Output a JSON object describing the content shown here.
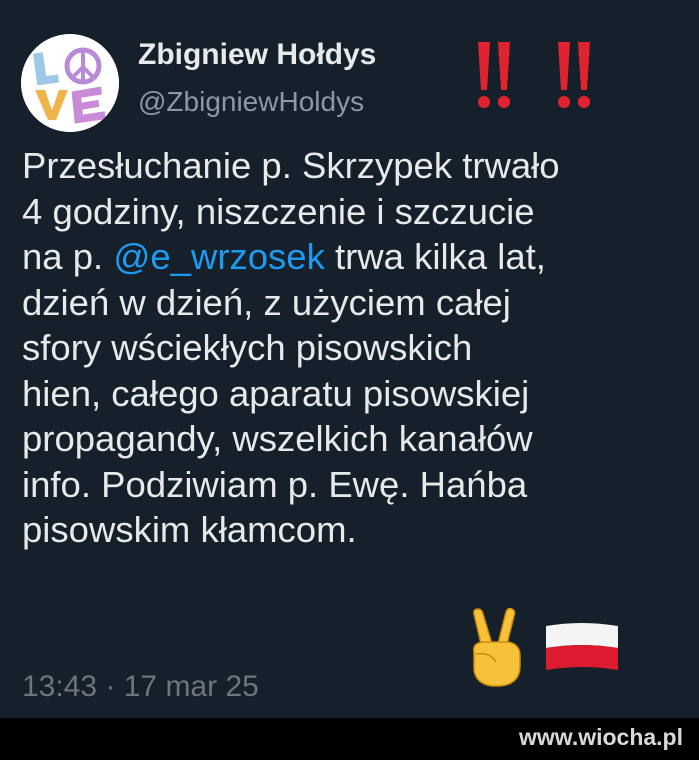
{
  "tweet": {
    "author_name": "Zbigniew Hołdys",
    "author_handle": "@ZbigniewHoldys",
    "avatar_text": "LOVE",
    "header_emoji": "!! !!",
    "body_lines": [
      {
        "before": "Przesłuchanie p. Skrzypek trwało",
        "mention": "",
        "after": ""
      },
      {
        "before": "4 godziny, niszczenie i szczucie",
        "mention": "",
        "after": ""
      },
      {
        "before": "na p. ",
        "mention": "@e_wrzosek",
        "after": " trwa kilka lat,"
      },
      {
        "before": "dzień w dzień, z użyciem całej",
        "mention": "",
        "after": ""
      },
      {
        "before": "sfory wściekłych pisowskich",
        "mention": "",
        "after": ""
      },
      {
        "before": "hien, całego aparatu pisowskiej",
        "mention": "",
        "after": ""
      },
      {
        "before": "propagandy, wszelkich kanałów",
        "mention": "",
        "after": ""
      },
      {
        "before": "info. Podziwiam p. Ewę. Hańba",
        "mention": "",
        "after": ""
      },
      {
        "before": "pisowskim kłamcom.",
        "mention": "",
        "after": ""
      }
    ],
    "trailing_emoji": [
      "victory-hand",
      "poland-flag"
    ],
    "timestamp": "13:43 · 17 mar 25",
    "colors": {
      "background": "#15202b",
      "text": "#e7e9ea",
      "secondary": "#8b98a5",
      "mention": "#1d9bf0",
      "alarm_red": "#e0242f"
    }
  },
  "watermark": "www.wiocha.pl"
}
